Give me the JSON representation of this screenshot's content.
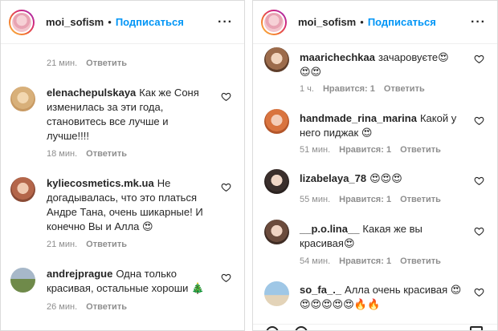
{
  "left": {
    "header": {
      "username": "moi_sofism",
      "dot": "•",
      "follow": "Подписаться",
      "more": "···"
    },
    "top_meta": {
      "time": "21 мин.",
      "reply": "Ответить"
    },
    "comments": [
      {
        "user": "elenachepulskaya",
        "lines": [
          "Как же Соня",
          "изменилась за эти года,",
          "становитесь все лучше и",
          "лучше!!!!"
        ],
        "time": "18 мин.",
        "reply": "Ответить"
      },
      {
        "user": "kyliecosmetics.mk.ua",
        "lines": [
          "Не",
          "догадывалась, что это платься",
          "Андре Тана, очень шикарные! И",
          "конечно Вы и Алла 😍"
        ],
        "time": "21 мин.",
        "reply": "Ответить"
      },
      {
        "user": "andrejprague",
        "lines": [
          "Одна только",
          "красивая, остальные хороши 🎄"
        ],
        "time": "26 мин.",
        "reply": "Ответить"
      }
    ]
  },
  "right": {
    "header": {
      "username": "moi_sofism",
      "dot": "•",
      "follow": "Подписаться",
      "more": "···"
    },
    "comments": [
      {
        "user": "maarichechkaa",
        "lines": [
          "зачаровуєте😍",
          "😍😍"
        ],
        "time": "1 ч.",
        "likes": "Нравится: 1",
        "reply": "Ответить"
      },
      {
        "user": "handmade_rina_marina",
        "lines": [
          "Какой у",
          "него пиджак 😍"
        ],
        "time": "51 мин.",
        "likes": "Нравится: 1",
        "reply": "Ответить"
      },
      {
        "user": "lizabelaya_78",
        "lines": [
          "😍😍😍"
        ],
        "time": "55 мин.",
        "likes": "Нравится: 1",
        "reply": "Ответить"
      },
      {
        "user": "__p.o.lina__",
        "lines": [
          "Какая же вы",
          "красивая😍"
        ],
        "time": "54 мин.",
        "likes": "Нравится: 1",
        "reply": "Ответить"
      },
      {
        "user": "so_fa_._",
        "lines": [
          "Алла очень красивая 😍",
          "😍😍😍😍😍🔥🔥"
        ],
        "time": "",
        "likes": "",
        "reply": ""
      }
    ]
  },
  "colors": {
    "accent": "#0095f6",
    "meta": "#8e8e8e",
    "text": "#262626",
    "border": "#dbdbdb"
  }
}
